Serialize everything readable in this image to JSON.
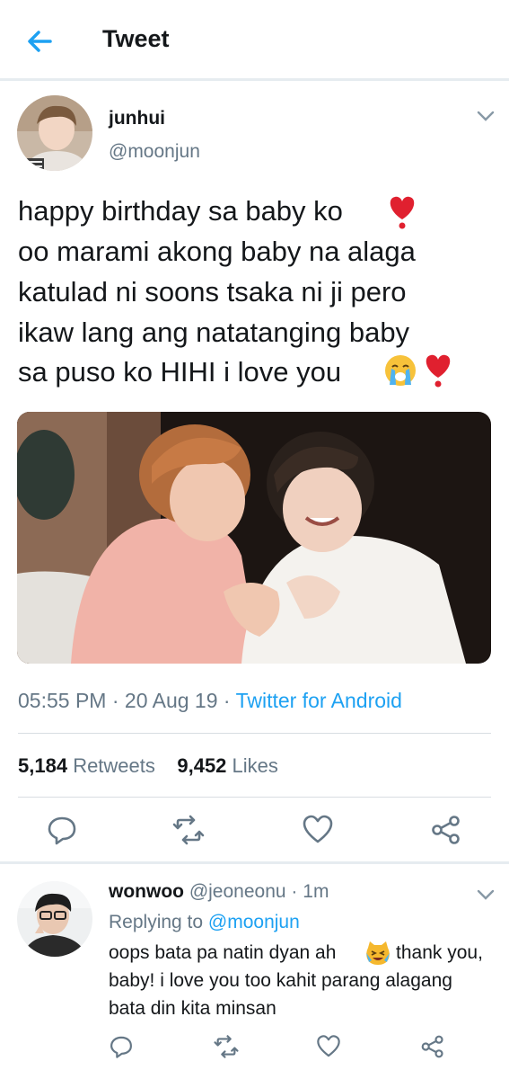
{
  "header": {
    "title": "Tweet",
    "back_icon": "arrow-left-icon",
    "accent": "#1da1f2"
  },
  "tweet": {
    "name": "junhui",
    "handle": "@moonjun",
    "text_lines": [
      "happy birthday sa baby ko",
      "oo marami akong baby na alaga",
      "katulad ni soons tsaka ni ji pero",
      "ikaw lang ang natatanging baby",
      "sa puso ko HIHI i love you"
    ],
    "time": "05:55 PM",
    "date": "20 Aug 19",
    "separator": "·",
    "source": "Twitter for Android",
    "retweets": "5,184",
    "retweets_label": "Retweets",
    "likes": "9,452",
    "likes_label": "Likes"
  },
  "reply": {
    "name": "wonwoo",
    "handle": "@jeoneonu",
    "dot": "·",
    "time": "1m",
    "replying_label": "Replying to",
    "replying_mention": "@moonjun",
    "text_lines": [
      "oops bata pa natin dyan ah",
      "thank you,",
      "baby! i love you too kahit parang alagang",
      "bata din kita minsan"
    ]
  },
  "icons": [
    "arrow-left-icon",
    "chevron-down-icon",
    "heart-emoji-icon",
    "crying-emoji-icon",
    "laughing-cat-emoji-icon",
    "reply-icon",
    "retweet-icon",
    "like-icon",
    "share-icon"
  ],
  "colors": {
    "secondary_text": "#657786",
    "link": "#1da1f2",
    "divider": "#e6ecf0"
  }
}
